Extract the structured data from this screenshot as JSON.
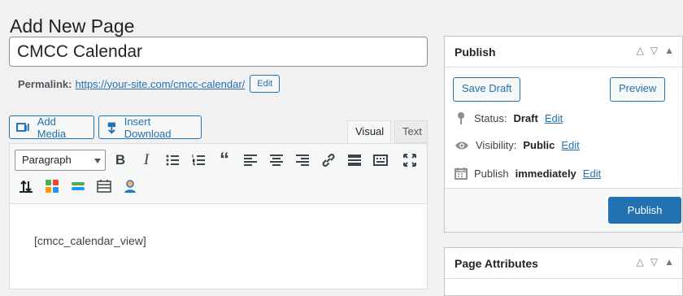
{
  "page_title": "Add New Page",
  "post_title": "CMCC Calendar",
  "permalink": {
    "label": "Permalink:",
    "url": "https://your-site.com/cmcc-calendar/",
    "edit_label": "Edit"
  },
  "media_buttons": {
    "add_media": "Add Media",
    "insert_download": "Insert Download"
  },
  "editor_tabs": {
    "visual": "Visual",
    "text": "Text"
  },
  "format_select": "Paragraph",
  "editor_content": "[cmcc_calendar_view]",
  "publish_box": {
    "title": "Publish",
    "save_draft": "Save Draft",
    "preview": "Preview",
    "status_label": "Status:",
    "status_value": "Draft",
    "visibility_label": "Visibility:",
    "visibility_value": "Public",
    "schedule_label": "Publish",
    "schedule_value": "immediately",
    "edit_link": "Edit",
    "publish_button": "Publish"
  },
  "page_attributes": {
    "title": "Page Attributes"
  },
  "colors": {
    "accent": "#2271b1",
    "background": "#f1f1f1",
    "border": "#c3c4c7"
  }
}
